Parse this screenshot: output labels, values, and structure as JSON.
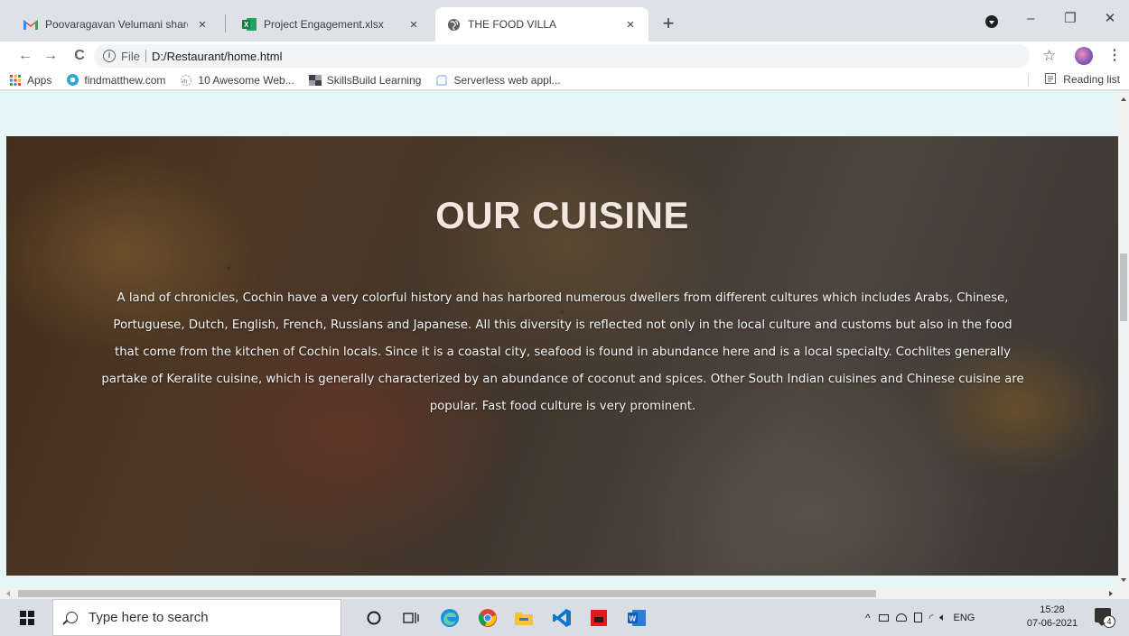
{
  "browser": {
    "tabs": [
      {
        "title": "Poovaragavan Velumani shared",
        "close": "×"
      },
      {
        "title": "Project Engagement.xlsx",
        "close": "×"
      },
      {
        "title": "THE FOOD VILLA",
        "close": "×"
      }
    ],
    "new_tab": "+",
    "window_controls": {
      "minimize": "–",
      "restore": "❐",
      "close": "✕"
    },
    "nav": {
      "back": "←",
      "forward": "→",
      "reload": "C"
    },
    "address": {
      "scheme": "File",
      "url": "D:/Restaurant/home.html"
    },
    "bookmark_star": "☆",
    "menu": "⋮",
    "bookmarks": [
      {
        "label": "Apps",
        "icon": "apps-grid-icon"
      },
      {
        "label": "findmatthew.com",
        "icon": "findmatthew-icon"
      },
      {
        "label": "10 Awesome Web...",
        "icon": "awesome-web-icon"
      },
      {
        "label": "SkillsBuild Learning",
        "icon": "skillsbuild-icon"
      },
      {
        "label": "Serverless web appl...",
        "icon": "serverless-icon"
      }
    ],
    "reading_list": "Reading list"
  },
  "page": {
    "hero_title": "OUR CUISINE",
    "hero_text": "A land of chronicles, Cochin have a very colorful history and has harbored numerous dwellers from different cultures which includes Arabs, Chinese, Portuguese, Dutch, English, French, Russians and Japanese. All this diversity is reflected not only in the local culture and customs but also in the food that come from the kitchen of Cochin locals. Since it is a coastal city, seafood is found in abundance here and is a local specialty. Cochlites generally partake of Keralite cuisine, which is generally characterized by an abundance of coconut and spices. Other South Indian cuisines and Chinese cuisine are popular. Fast food culture is very prominent."
  },
  "taskbar": {
    "search_placeholder": "Type here to search",
    "apps": [
      "cortana-icon",
      "task-view-icon",
      "edge-icon",
      "chrome-icon",
      "file-explorer-icon",
      "vscode-icon",
      "app-red-icon",
      "word-icon"
    ],
    "language": "ENG",
    "time": "15:28",
    "date": "07-06-2021",
    "notifications": "4"
  },
  "colors": {
    "tab_strip": "#dee1e6",
    "page_bg": "#e6f5f5",
    "hero_title": "#f3e6df",
    "taskbar": "#d9dde4"
  }
}
